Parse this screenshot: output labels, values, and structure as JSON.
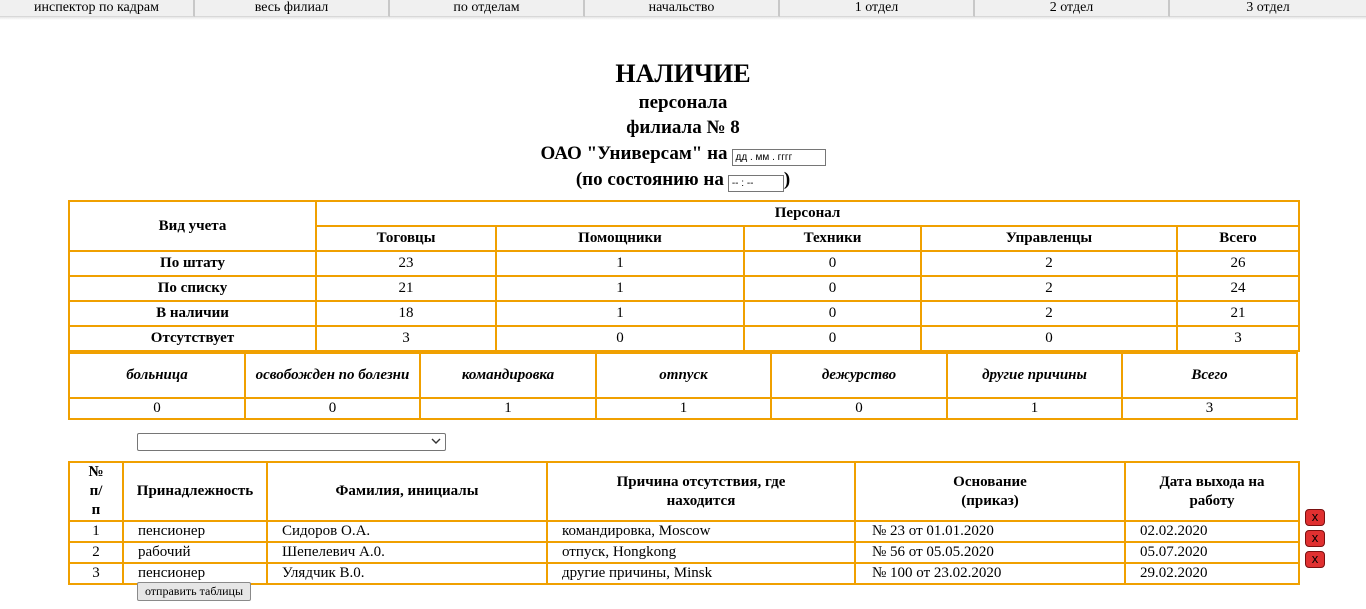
{
  "nav": {
    "tabs": [
      "инспектор по кадрам",
      "весь филиал",
      "по отделам",
      "начальство",
      "1 отдел",
      "2 отдел",
      "3 отдел"
    ]
  },
  "heading": {
    "title": "НАЛИЧИЕ",
    "line1": "персонала",
    "line2": "филиала № 8",
    "line3": "ОАО \"Универсам\" на",
    "date_placeholder": "дд . мм . гггг",
    "line4_open": "(по состоянию на",
    "time_placeholder": "-- : --",
    "line4_close": ")"
  },
  "staff_table": {
    "row_header": "Вид учета",
    "group_header": "Персонал",
    "columns": [
      "Тоговцы",
      "Помощники",
      "Техники",
      "Управленцы",
      "Всего"
    ],
    "rows": [
      {
        "label": "По штату",
        "values": [
          "23",
          "1",
          "0",
          "2",
          "26"
        ]
      },
      {
        "label": "По списку",
        "values": [
          "21",
          "1",
          "0",
          "2",
          "24"
        ]
      },
      {
        "label": "В наличии",
        "values": [
          "18",
          "1",
          "0",
          "2",
          "21"
        ]
      },
      {
        "label": "Отсутствует",
        "values": [
          "3",
          "0",
          "0",
          "0",
          "3"
        ]
      }
    ]
  },
  "absence_table": {
    "columns": [
      "больница",
      "освобожден по болезни",
      "командировка",
      "отпуск",
      "дежурство",
      "другие причины",
      "Всего"
    ],
    "values": [
      "0",
      "0",
      "1",
      "1",
      "0",
      "1",
      "3"
    ]
  },
  "select": {
    "value": ""
  },
  "absent_list": {
    "columns": [
      "№ п/п",
      "Принадлежность",
      "Фамилия, инициалы",
      "Причина отсутствия, где находится",
      "Основание (приказ)",
      "Дата выхода на работу"
    ],
    "rows": [
      {
        "num": "1",
        "affiliation": "пенсионер",
        "name": "Сидоров О.А.",
        "reason": "командировка, Moscow",
        "basis": "№ 23 от 01.01.2020",
        "return_date": "02.02.2020"
      },
      {
        "num": "2",
        "affiliation": "рабочий",
        "name": "Шепелевич А.0.",
        "reason": "отпуск, Hongkong",
        "basis": "№ 56 от 05.05.2020",
        "return_date": "05.07.2020"
      },
      {
        "num": "3",
        "affiliation": "пенсионер",
        "name": "Улядчик В.0.",
        "reason": "другие причины, Minsk",
        "basis": "№ 100 от 23.02.2020",
        "return_date": "29.02.2020"
      }
    ],
    "delete_label": "x"
  },
  "send_button": "отправить таблицы",
  "colors": {
    "border": "#f0a000",
    "delete": "#e03030"
  }
}
